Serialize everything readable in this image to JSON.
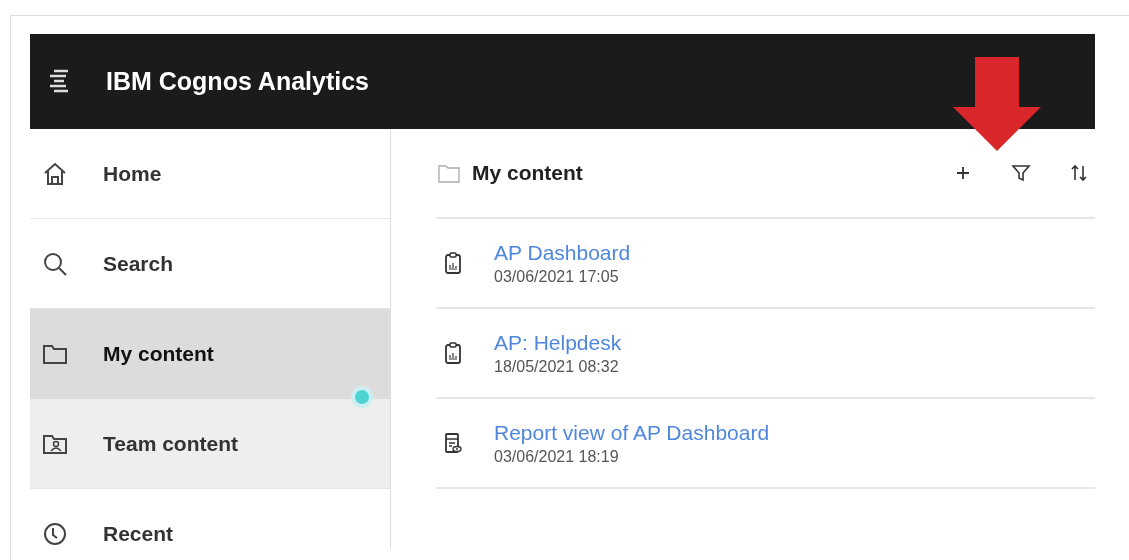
{
  "app": {
    "title": "IBM Cognos Analytics"
  },
  "sidebar": {
    "items": [
      {
        "label": "Home",
        "kind": "home",
        "selected": false,
        "hovered": false
      },
      {
        "label": "Search",
        "kind": "search",
        "selected": false,
        "hovered": false
      },
      {
        "label": "My content",
        "kind": "folder",
        "selected": true,
        "hovered": false
      },
      {
        "label": "Team content",
        "kind": "team_folder",
        "selected": false,
        "hovered": true
      },
      {
        "label": "Recent",
        "kind": "clock",
        "selected": false,
        "hovered": false
      }
    ]
  },
  "content": {
    "title": "My content",
    "items": [
      {
        "kind": "dashboard",
        "name": "AP Dashboard",
        "modified": "03/06/2021 17:05"
      },
      {
        "kind": "dashboard",
        "name": "AP: Helpdesk",
        "modified": "18/05/2021 08:32"
      },
      {
        "kind": "report_view",
        "name": "Report view of AP Dashboard",
        "modified": "03/06/2021 18:19"
      }
    ]
  }
}
